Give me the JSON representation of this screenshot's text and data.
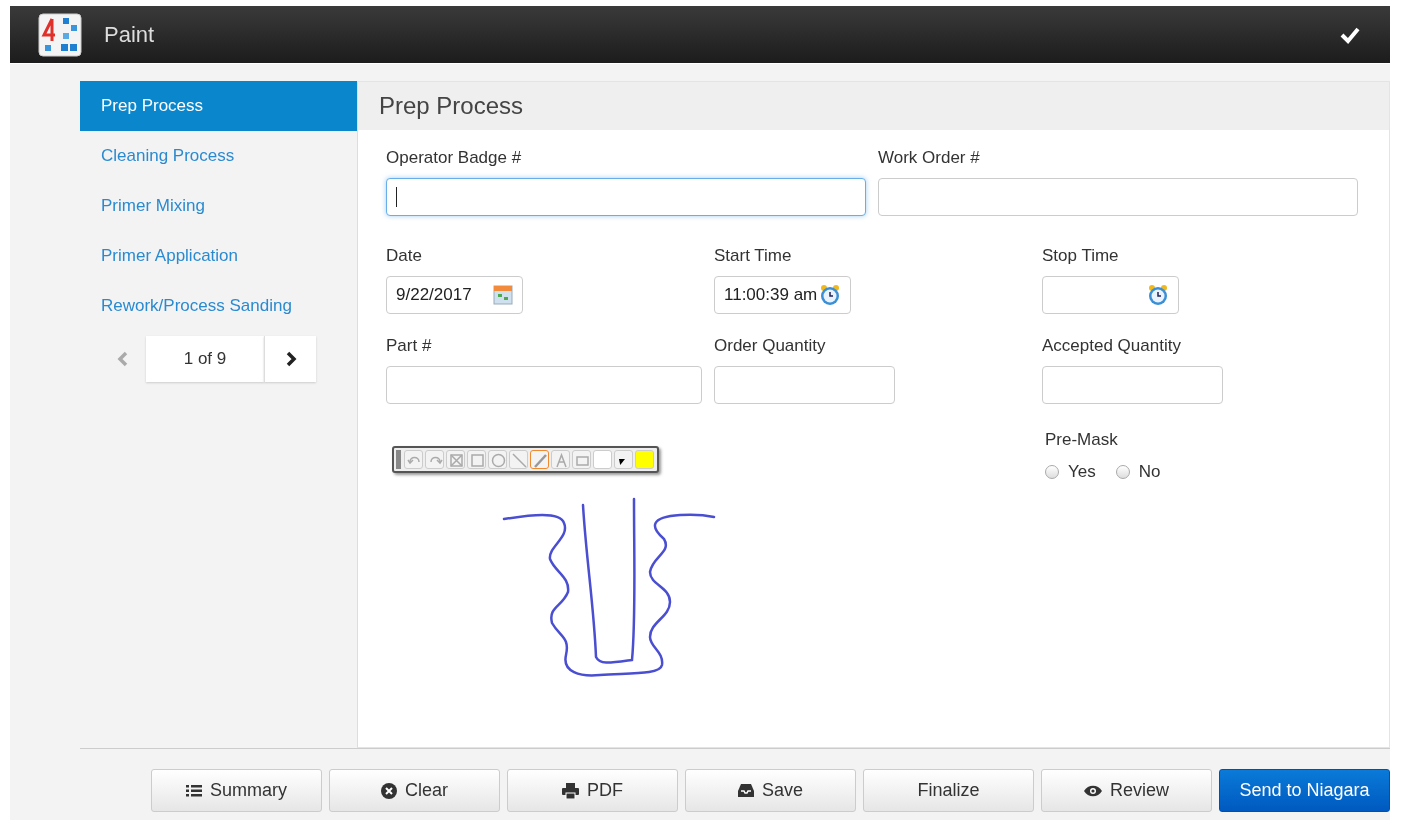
{
  "window": {
    "title": "Paint"
  },
  "sidebar": {
    "items": [
      {
        "label": "Prep Process",
        "selected": true
      },
      {
        "label": "Cleaning Process",
        "selected": false
      },
      {
        "label": "Primer Mixing",
        "selected": false
      },
      {
        "label": "Primer Application",
        "selected": false
      },
      {
        "label": "Rework/Process Sanding",
        "selected": false
      }
    ],
    "pager": {
      "text": "1 of 9",
      "prev_disabled": true
    }
  },
  "form": {
    "title": "Prep Process",
    "rows": [
      [
        {
          "label": "Operator Badge #",
          "kind": "text",
          "focused": true
        },
        {
          "label": "Work Order #",
          "kind": "text",
          "focused": false
        }
      ],
      [
        {
          "label": "Date",
          "kind": "date",
          "value": "9/22/2017",
          "focused": false
        },
        {
          "label": "Start Time",
          "kind": "time",
          "value": "11:00:39 am",
          "focused": false
        },
        {
          "label": "Stop Time",
          "kind": "time",
          "focused": false
        }
      ],
      [
        {
          "label": "Part #",
          "kind": "text",
          "focused": false
        },
        {
          "label": "Order Quantity",
          "kind": "text",
          "focused": false
        },
        {
          "label": "Accepted Quantity",
          "kind": "text",
          "focused": false
        }
      ]
    ],
    "draw_tools": [
      {
        "kind": "undo",
        "selected": false
      },
      {
        "kind": "redo",
        "selected": false
      },
      {
        "kind": "clear",
        "selected": false
      },
      {
        "kind": "rect",
        "selected": false
      },
      {
        "kind": "circle",
        "selected": false
      },
      {
        "kind": "line",
        "selected": false
      },
      {
        "kind": "pen",
        "selected": true
      },
      {
        "kind": "text",
        "selected": false
      },
      {
        "kind": "eraser",
        "selected": false
      },
      {
        "kind": "swatch",
        "color": "#ffffff",
        "selected": false
      },
      {
        "kind": "size",
        "selected": false
      },
      {
        "kind": "swatch",
        "color": "#ffff00",
        "selected": false
      }
    ],
    "premask": {
      "label": "Pre-Mask",
      "options": [
        {
          "label": "Yes",
          "selected": false
        },
        {
          "label": "No",
          "selected": false
        }
      ]
    }
  },
  "buttons": [
    {
      "label": "Summary",
      "kind": "list",
      "primary": false
    },
    {
      "label": "Clear",
      "kind": "clear",
      "primary": false
    },
    {
      "label": "PDF",
      "kind": "print",
      "primary": false
    },
    {
      "label": "Save",
      "kind": "save",
      "primary": false
    },
    {
      "label": "Finalize",
      "kind": "none",
      "primary": false
    },
    {
      "label": "Review",
      "kind": "eye",
      "primary": false
    },
    {
      "label": "Send to Niagara",
      "kind": "none",
      "primary": true
    }
  ]
}
